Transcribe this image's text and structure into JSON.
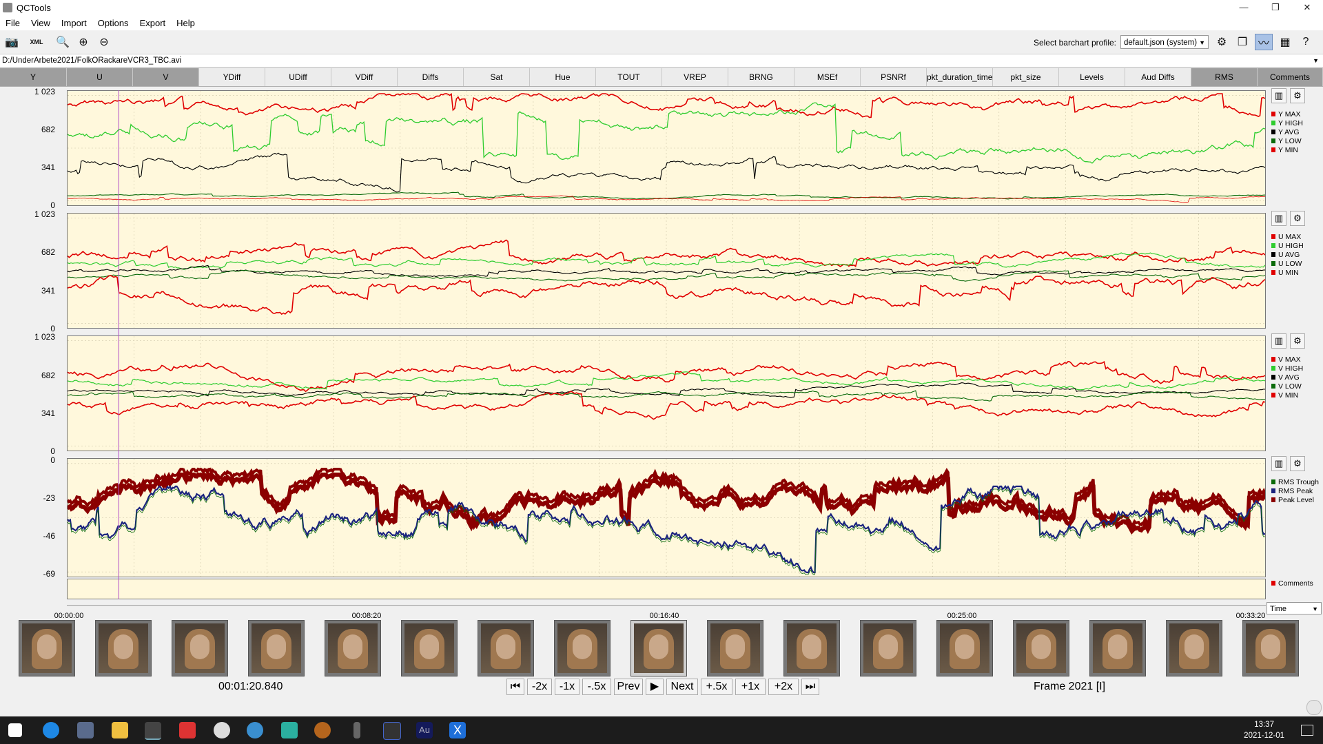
{
  "window": {
    "title": "QCTools",
    "controls": [
      "—",
      "❐",
      "✕"
    ]
  },
  "menu": [
    "File",
    "View",
    "Import",
    "Options",
    "Export",
    "Help"
  ],
  "toolbar": {
    "profile_label": "Select barchart profile:",
    "profile_value": "default.json (system)"
  },
  "file_path": "D:/UnderArbete2021/FolkORackareVCR3_TBC.avi",
  "filter_tabs": [
    {
      "label": "Y",
      "active": true
    },
    {
      "label": "U",
      "active": true
    },
    {
      "label": "V",
      "active": true
    },
    {
      "label": "YDiff",
      "active": false
    },
    {
      "label": "UDiff",
      "active": false
    },
    {
      "label": "VDiff",
      "active": false
    },
    {
      "label": "Diffs",
      "active": false
    },
    {
      "label": "Sat",
      "active": false
    },
    {
      "label": "Hue",
      "active": false
    },
    {
      "label": "TOUT",
      "active": false
    },
    {
      "label": "VREP",
      "active": false
    },
    {
      "label": "BRNG",
      "active": false
    },
    {
      "label": "MSEf",
      "active": false
    },
    {
      "label": "PSNRf",
      "active": false
    },
    {
      "label": "pkt_duration_time",
      "active": false
    },
    {
      "label": "pkt_size",
      "active": false
    },
    {
      "label": "Levels",
      "active": false
    },
    {
      "label": "Aud Diffs",
      "active": false
    },
    {
      "label": "RMS",
      "active": true
    },
    {
      "label": "Comments",
      "active": true
    }
  ],
  "plots": [
    {
      "id": "y",
      "yticks": [
        "1 023",
        "682",
        "341",
        "0"
      ],
      "legend": [
        {
          "label": "Y MAX",
          "color": "#e00000"
        },
        {
          "label": "Y HIGH",
          "color": "#2ecc2e"
        },
        {
          "label": "Y AVG",
          "color": "#000000"
        },
        {
          "label": "Y LOW",
          "color": "#0a6a0a"
        },
        {
          "label": "Y MIN",
          "color": "#e00000"
        }
      ]
    },
    {
      "id": "u",
      "yticks": [
        "1 023",
        "682",
        "341",
        "0"
      ],
      "legend": [
        {
          "label": "U MAX",
          "color": "#e00000"
        },
        {
          "label": "U HIGH",
          "color": "#2ecc2e"
        },
        {
          "label": "U AVG",
          "color": "#000000"
        },
        {
          "label": "U LOW",
          "color": "#0a6a0a"
        },
        {
          "label": "U MIN",
          "color": "#e00000"
        }
      ]
    },
    {
      "id": "v",
      "yticks": [
        "1 023",
        "682",
        "341",
        "0"
      ],
      "legend": [
        {
          "label": "V MAX",
          "color": "#e00000"
        },
        {
          "label": "V HIGH",
          "color": "#2ecc2e"
        },
        {
          "label": "V AVG",
          "color": "#000000"
        },
        {
          "label": "V LOW",
          "color": "#0a6a0a"
        },
        {
          "label": "V MIN",
          "color": "#e00000"
        }
      ]
    },
    {
      "id": "rms",
      "yticks": [
        "0",
        "-23",
        "-46",
        "-69"
      ],
      "legend": [
        {
          "label": "RMS Trough",
          "color": "#0a6a0a"
        },
        {
          "label": "RMS Peak",
          "color": "#1a237e"
        },
        {
          "label": "Peak Level",
          "color": "#8b0000"
        }
      ]
    }
  ],
  "comments_legend": {
    "label": "Comments",
    "color": "#e00000"
  },
  "time_axis": {
    "labels": [
      "00:00:00",
      "00:08:20",
      "00:16:40",
      "00:25:00",
      "00:33:20"
    ],
    "mode": "Time"
  },
  "playback": {
    "timecode": "00:01:20.840",
    "frame": "Frame 2021 [I]",
    "buttons": [
      "-2x",
      "-1x",
      "-.5x",
      "Prev",
      "Next",
      "+.5x",
      "+1x",
      "+2x"
    ]
  },
  "taskbar": {
    "time": "13:37",
    "date": "2021-12-01"
  }
}
